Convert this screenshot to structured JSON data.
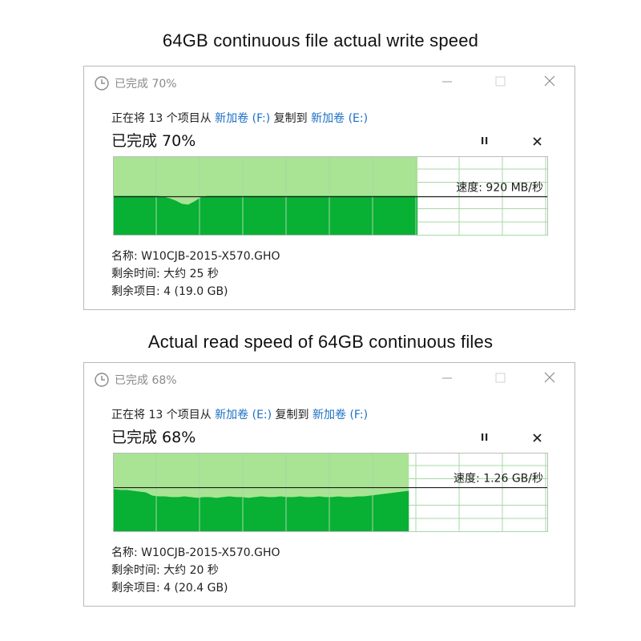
{
  "headings": {
    "write": "64GB continuous file actual write speed",
    "read": "Actual read speed of 64GB continuous files"
  },
  "colors": {
    "fill_light": "#a8e494",
    "fill_dark": "#08b034",
    "grid": "#a5d8a5",
    "link": "#1a6fc4"
  },
  "dialogs": [
    {
      "title": "已完成 70%",
      "copy_prefix": "正在将 13 个项目从 ",
      "source": "新加卷 (F:)",
      "copy_mid": " 复制到 ",
      "dest": "新加卷 (E:)",
      "percent_text": "已完成 70%",
      "progress": 0.7,
      "speed_text": "速度: 920 MB/秒",
      "speed_level": 0.49,
      "name_text": "名称: W10CJB-2015-X570.GHO",
      "time_text": "剩余时间: 大约 25 秒",
      "items_text": "剩余项目: 4 (19.0 GB)",
      "throughput": [
        0.5,
        0.5,
        0.5,
        0.5,
        0.5,
        0.5,
        0.5,
        0.5,
        0.49,
        0.47,
        0.44,
        0.4,
        0.39,
        0.43,
        0.48,
        0.5,
        0.5,
        0.5,
        0.5,
        0.5,
        0.5,
        0.5,
        0.5,
        0.5,
        0.5,
        0.5,
        0.5,
        0.5,
        0.5,
        0.5,
        0.5,
        0.5,
        0.5,
        0.5,
        0.5,
        0.5,
        0.5,
        0.5,
        0.5,
        0.5,
        0.5,
        0.5,
        0.5,
        0.5,
        0.5,
        0.5,
        0.5,
        0.5,
        0.5,
        0.5
      ],
      "icons": [
        "clock-icon",
        "minimize-icon",
        "maximize-icon",
        "close-icon",
        "pause-icon",
        "cancel-icon"
      ]
    },
    {
      "title": "已完成 68%",
      "copy_prefix": "正在将 13 个项目从 ",
      "source": "新加卷 (E:)",
      "copy_mid": " 复制到 ",
      "dest": "新加卷 (F:)",
      "percent_text": "已完成 68%",
      "progress": 0.68,
      "speed_text": "速度: 1.26 GB/秒",
      "speed_level": 0.56,
      "name_text": "名称: W10CJB-2015-X570.GHO",
      "time_text": "剩余时间: 大约 20 秒",
      "items_text": "剩余项目: 4 (20.4 GB)",
      "throughput": [
        0.54,
        0.53,
        0.53,
        0.52,
        0.51,
        0.5,
        0.46,
        0.45,
        0.45,
        0.44,
        0.44,
        0.45,
        0.44,
        0.43,
        0.44,
        0.44,
        0.43,
        0.44,
        0.45,
        0.44,
        0.44,
        0.43,
        0.44,
        0.45,
        0.44,
        0.44,
        0.45,
        0.44,
        0.44,
        0.45,
        0.44,
        0.44,
        0.45,
        0.44,
        0.44,
        0.45,
        0.44,
        0.44,
        0.45,
        0.45,
        0.46,
        0.47,
        0.48,
        0.49,
        0.5,
        0.51,
        0.52
      ],
      "icons": [
        "clock-icon",
        "minimize-icon",
        "maximize-icon",
        "close-icon",
        "pause-icon",
        "cancel-icon"
      ]
    }
  ]
}
